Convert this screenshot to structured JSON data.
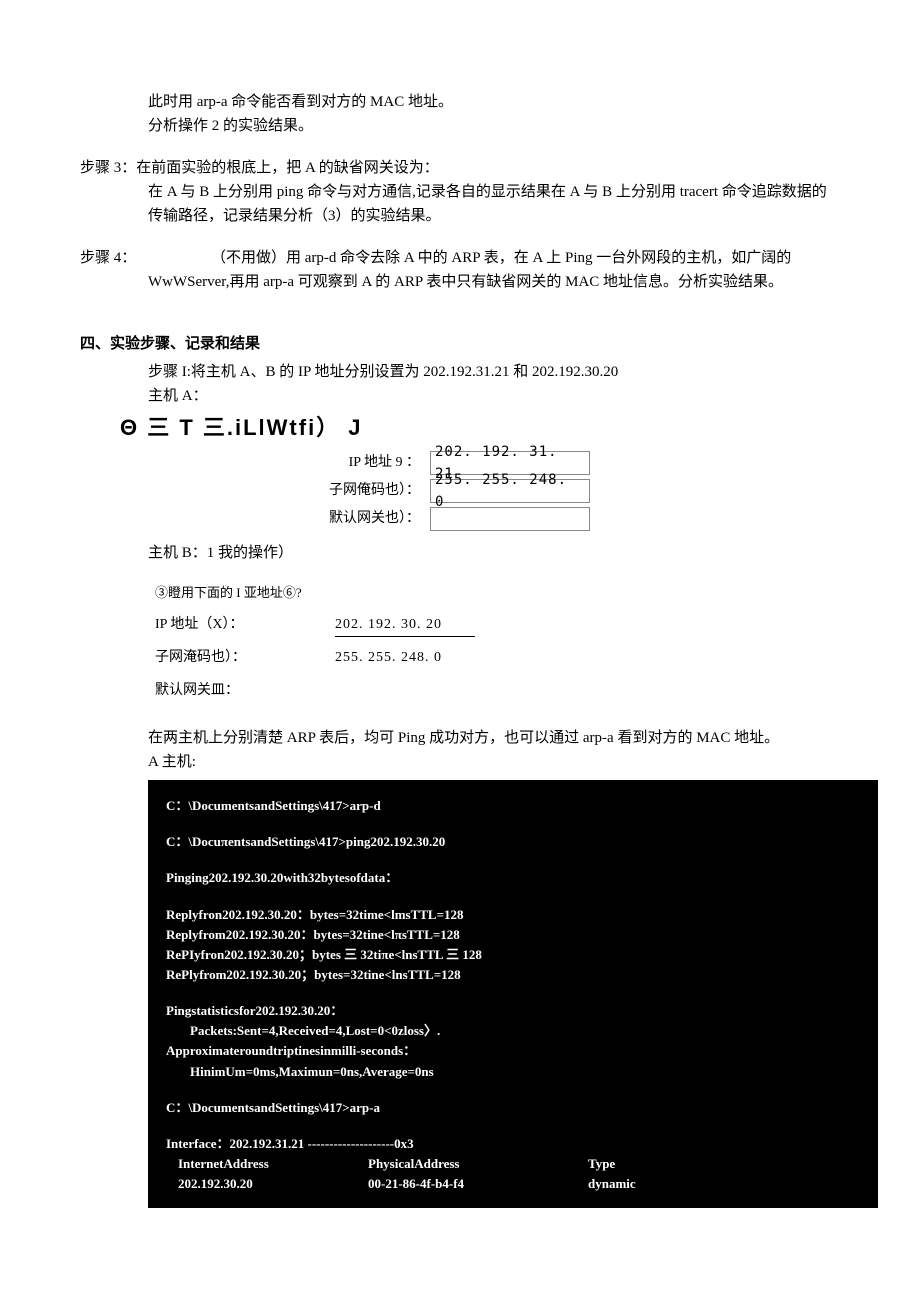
{
  "intro": {
    "l1": "此时用 arp-a 命令能否看到对方的 MAC 地址。",
    "l2": "分析操作 2 的实验结果。"
  },
  "step3": {
    "label": "步骤 3：",
    "l1": "在前面实验的根底上，把 A 的缺省网关设为：",
    "l2": "在 A 与 B 上分别用 ping 命令与对方通信,记录各自的显示结果在 A 与 B 上分别用 tracert 命令追踪数据的传输路径，记录结果分析（3）的实验结果。"
  },
  "step4": {
    "label": "步骤 4：",
    "l1": "（不用做）用 arp-d 命令去除 A 中的 ARP 表，在 A 上 Ping 一台外网段的主机，如广阔的WwWServer,再用 arp-a 可观察到 A 的 ARP 表中只有缺省网关的 MAC 地址信息。分析实验结果。"
  },
  "section4": {
    "head": "四、实验步骤、记录和结果",
    "stepI": "步骤 I:将主机 A、B 的 IP 地址分别设置为 202.192.31.21 和 202.192.30.20",
    "hostA_label": "主机 A：",
    "garble": "Θ 三 T 三.iLlWtfi） J",
    "formA": {
      "ip_label": "IP 地址 9 ：",
      "ip_val": "202. 192. 31. 21",
      "mask_label": "子网俺码也）：",
      "mask_val": "255. 255. 248. 0",
      "gw_label": "默认网关也）："
    },
    "hostB_label": "主机 B：1 我的操作）",
    "formB": {
      "opt": "③瞪用下面的 I 亚地址⑥?",
      "ip_label": "IP 地址（X）：",
      "ip_val": "202. 192. 30. 20",
      "mask_label": "子网淹码也）：",
      "mask_val": "255. 255. 248. 0",
      "gw_label": "默认网关皿："
    },
    "para": "在两主机上分别清楚 ARP 表后，均可 Ping 成功对方，也可以通过 arp-a 看到对方的 MAC 地址。",
    "para2": "A 主机:"
  },
  "terminal": {
    "l1": "C：\\DocumentsandSettings\\417>arp-d",
    "l2": "C：\\DocuπentsandSettings\\417>ping202.192.30.20",
    "l3": "Pinging202.192.30.20with32bytesofdata：",
    "l4": "Replyfron202.192.30.20：bytes=32time<lmsTTL=128",
    "l5": "Replyfrom202.192.30.20：bytes=32tine<lπsTTL=128",
    "l6": "RePIyfron202.192.30.20；bytes 三 32tiπe<lnsTTL 三 128",
    "l7": "RePlyfrom202.192.30.20；bytes=32tine<lnsTTL=128",
    "l8": "Pingstatisticsfor202.192.30.20：",
    "l9": "Packets:Sent=4,Received=4,Lost=0<0zloss〉.",
    "l10": "Approximateroundtriptinesinmilli-seconds：",
    "l11": "HinimUm=0ms,Maximun=0ns,Average=0ns",
    "l12": "C：\\DocumentsandSettings\\417>arp-a",
    "l13": "Interface：202.192.31.21 --------------------0x3",
    "h1": "InternetAddress",
    "h2": "PhysicalAddress",
    "h3": "Type",
    "r1": "202.192.30.20",
    "r2": "00-21-86-4f-b4-f4",
    "r3": "dynamic"
  }
}
